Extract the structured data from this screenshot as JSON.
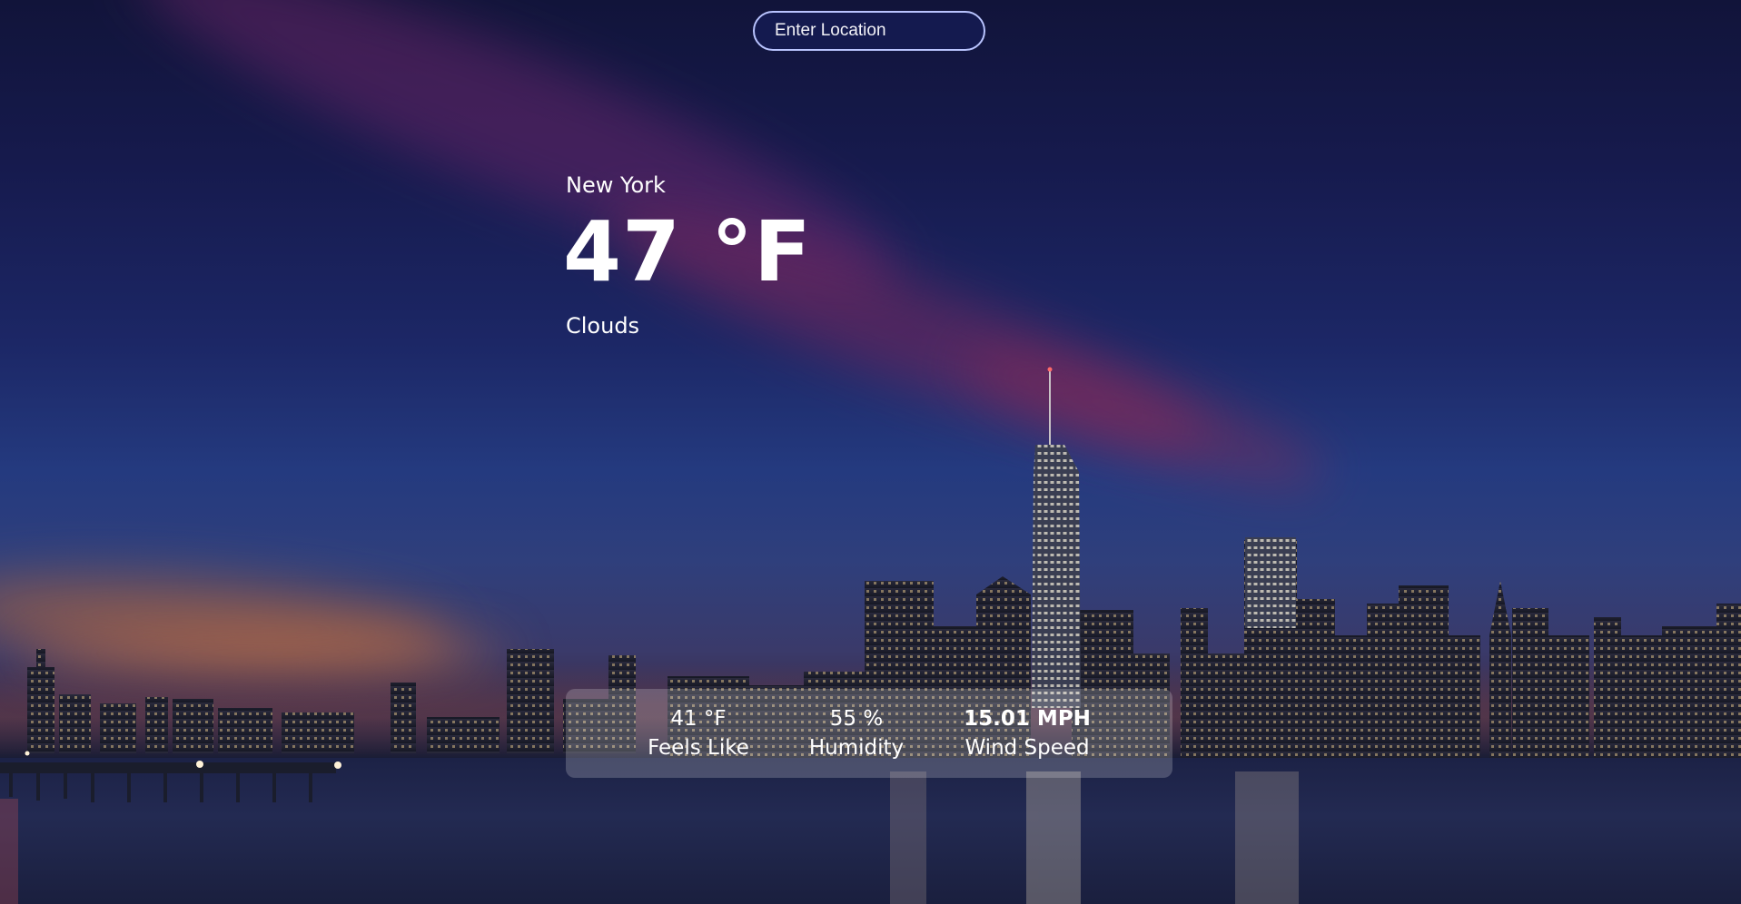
{
  "search": {
    "placeholder": "Enter Location"
  },
  "weather": {
    "city": "New York",
    "temperature": "47 °F",
    "description": "Clouds"
  },
  "details": {
    "feels_like": {
      "value": "41 °F",
      "label": "Feels Like"
    },
    "humidity": {
      "value": "55 %",
      "label": "Humidity"
    },
    "wind_speed": {
      "value": "15.01 MPH",
      "label": "Wind Speed"
    }
  },
  "colors": {
    "sky_top": "#11143a",
    "sky_mid": "#243a7f",
    "sunset": "#c46a3c",
    "input_border": "#b9c4ff"
  }
}
